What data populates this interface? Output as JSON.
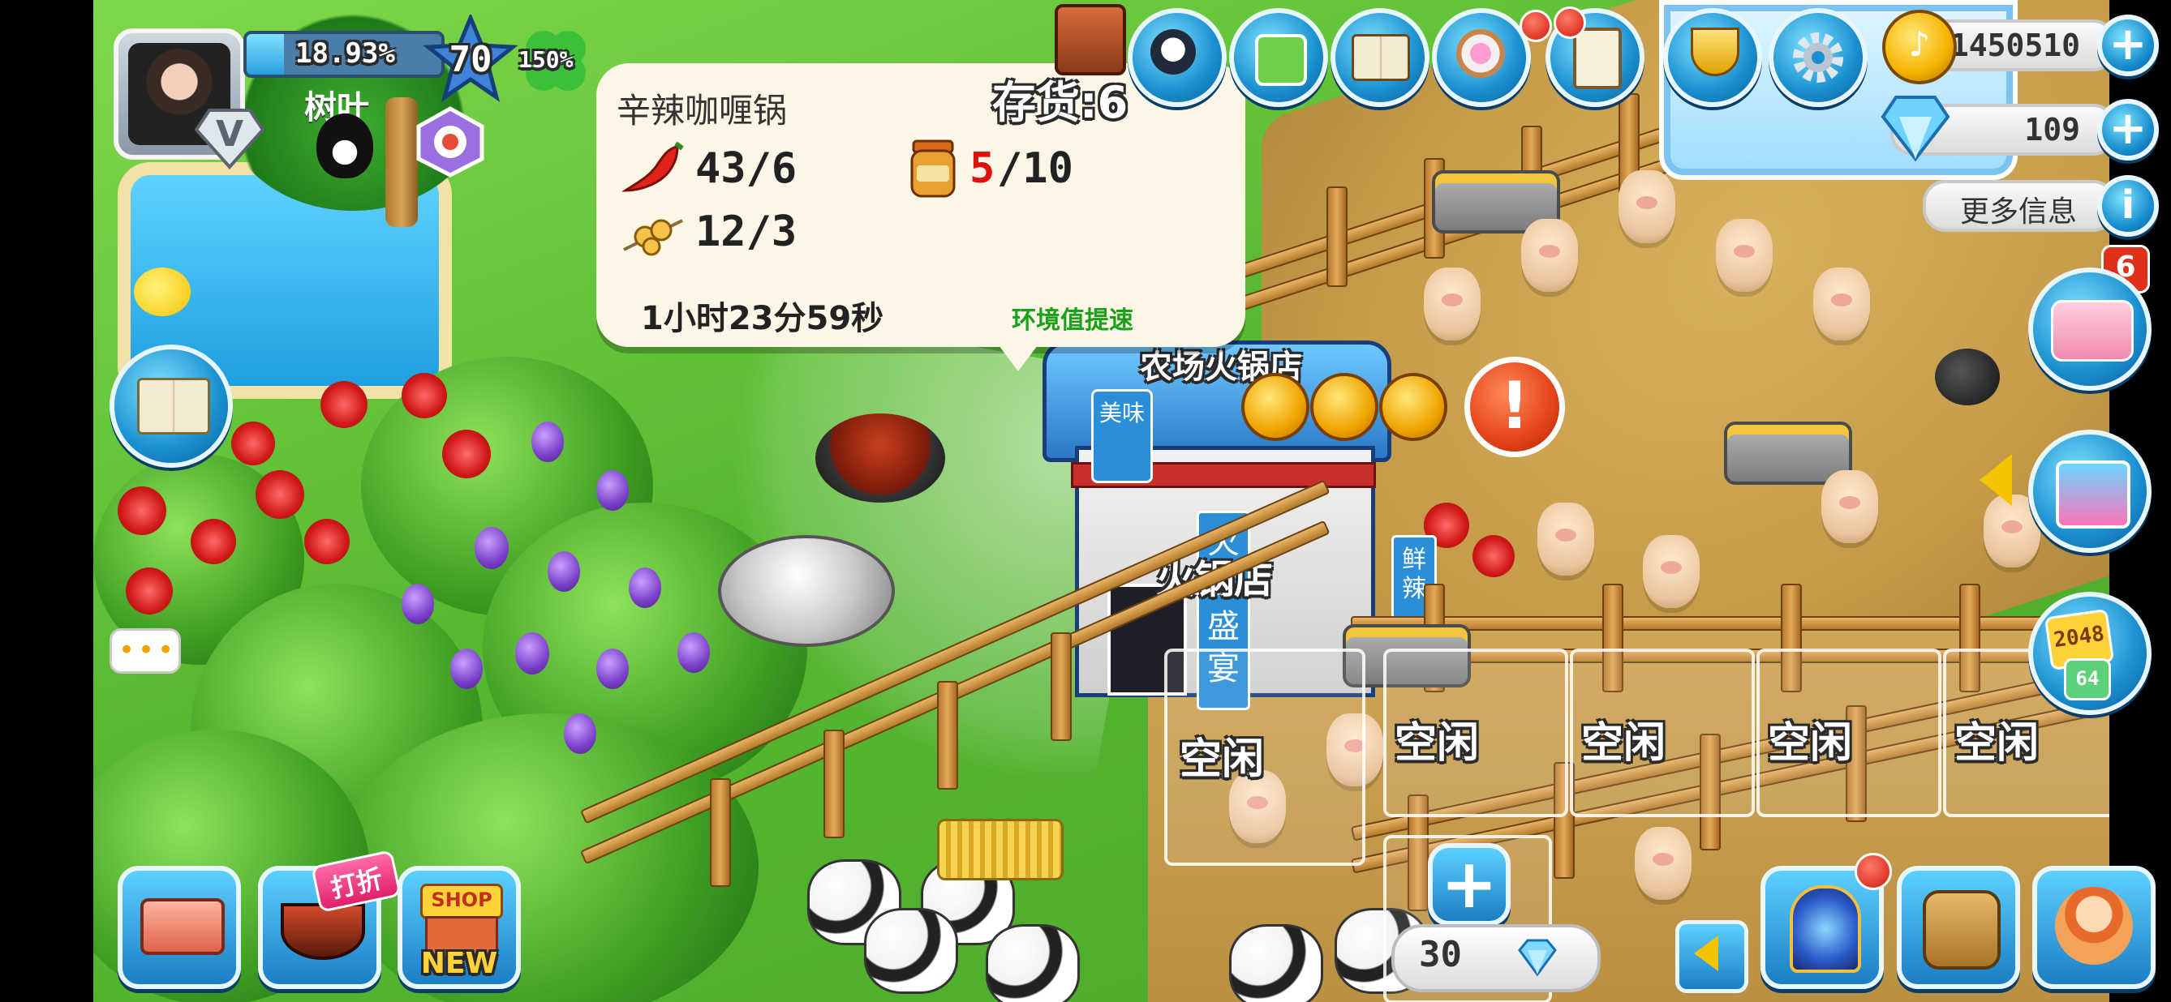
{
  "player": {
    "name": "树叶",
    "exp_percent": "18.93%",
    "level": "70",
    "bonus": "150%",
    "vip_label": "V"
  },
  "currency": {
    "coins": "1450510",
    "diamonds": "109",
    "more_info": "更多信息"
  },
  "notifications": {
    "side_badge": "6"
  },
  "production_popup": {
    "title": "辛辣咖喱锅",
    "stock_label": "存货:6",
    "ingredients": [
      {
        "icon": "chili-icon",
        "have": "43",
        "need": "6",
        "text": "43/6"
      },
      {
        "icon": "jar-icon",
        "have": "5",
        "need": "10",
        "have_text": "5",
        "rest_text": "/10"
      },
      {
        "icon": "skewer-icon",
        "have": "12",
        "need": "3",
        "text": "12/3"
      }
    ],
    "timer": "1小时23分59秒",
    "boost_link": "环境值提速",
    "short_color": "#e01010",
    "boost_color": "#1aa01a"
  },
  "building": {
    "name": "火锅店",
    "sign_top": "农场火锅店",
    "sign_side": "火锅盛宴",
    "sign_left": "美味",
    "sign_right": "鲜辣",
    "stars": 3
  },
  "pen_slots": [
    {
      "label": "空闲"
    },
    {
      "label": "空闲"
    },
    {
      "label": "空闲"
    },
    {
      "label": "空闲"
    },
    {
      "label": "空闲"
    }
  ],
  "expand_slot": {
    "cost": "30"
  },
  "bottom_left": {
    "discount_label": "打折",
    "shop_label": "SHOP",
    "new_label": "NEW"
  },
  "side_panel": {
    "game_2048": "2048",
    "game_64": "64"
  },
  "chat": {
    "dots": "•••"
  },
  "colors": {
    "grass": "#5cc23a",
    "dirt": "#c9a052",
    "popup_bg": "#fbf6e6",
    "accent_blue": "#1a8fd0"
  }
}
